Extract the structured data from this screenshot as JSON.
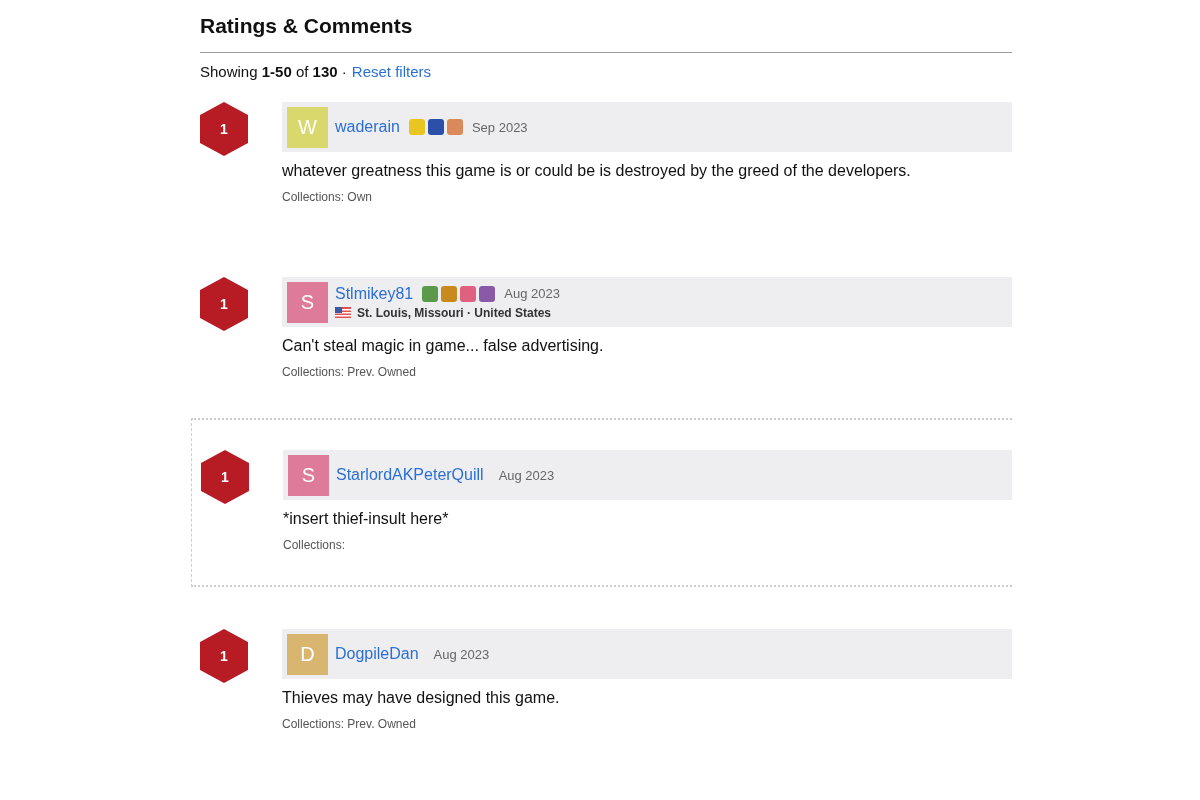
{
  "section": {
    "title": "Ratings & Comments",
    "showing": "Showing **1-50** of **130** ·",
    "reset_link": "Reset filters"
  },
  "comments": [
    {
      "rating": "1",
      "avatar_letter": "W",
      "color": "#d8d86c",
      "username": "waderain",
      "badges": [
        {
          "color": "#e8c520"
        },
        {
          "color": "#2c4fa8"
        },
        {
          "color": "#d9895a"
        }
      ],
      "date": "Sep 2023",
      "text": "whatever greatness this game is or could be is destroyed by the greed of the developers.",
      "collections": "Collections: Own",
      "highlighted": false
    },
    {
      "rating": "1",
      "avatar_letter": "S",
      "color": "#de7b9b",
      "username": "Stlmikey81",
      "badges": [
        {
          "color": "#5a9a4a"
        },
        {
          "color": "#c88a1c"
        },
        {
          "color": "#e06080"
        },
        {
          "color": "#8a5aa8"
        }
      ],
      "date": "Aug 2023",
      "location": "St. Louis, Missouri · United States",
      "text": "Can't steal magic in game... false advertising.",
      "collections": "Collections: Prev. Owned",
      "highlighted": false
    },
    {
      "rating": "1",
      "avatar_letter": "S",
      "color": "#de7b9b",
      "username": "StarlordAKPeterQuill",
      "date": "Aug 2023",
      "text": "*insert thief-insult here*",
      "collections": "Collections:",
      "highlighted": true
    },
    {
      "rating": "1",
      "avatar_letter": "D",
      "color": "#d9b670",
      "username": "DogpileDan",
      "date": "Aug 2023",
      "text": "Thieves may have designed this game.",
      "collections": "Collections: Prev. Owned",
      "highlighted": false
    }
  ]
}
